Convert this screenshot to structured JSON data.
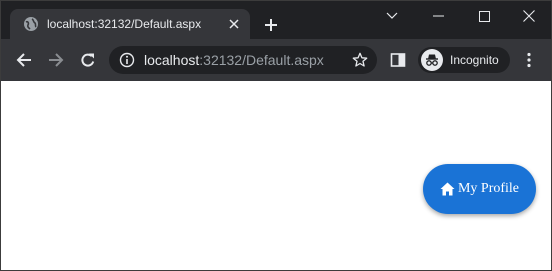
{
  "window": {
    "tab_title": "localhost:32132/Default.aspx"
  },
  "toolbar": {
    "url_host": "localhost",
    "url_rest": ":32132/Default.aspx",
    "incognito_label": "Incognito"
  },
  "page": {
    "profile_button_label": "My Profile"
  },
  "colors": {
    "titlebar_bg": "#202124",
    "toolbar_bg": "#35363a",
    "profile_button_bg": "#1a73d6"
  },
  "icons": {
    "tab_favicon": "globe-icon",
    "tab_close": "close-icon",
    "new_tab": "plus-icon",
    "back": "arrow-left-icon",
    "forward": "arrow-right-icon",
    "reload": "reload-icon",
    "site_info": "info-icon",
    "bookmark": "star-icon",
    "side_panel": "side-panel-icon",
    "incognito": "incognito-icon",
    "menu": "kebab-menu-icon",
    "profile_button": "home-icon"
  }
}
